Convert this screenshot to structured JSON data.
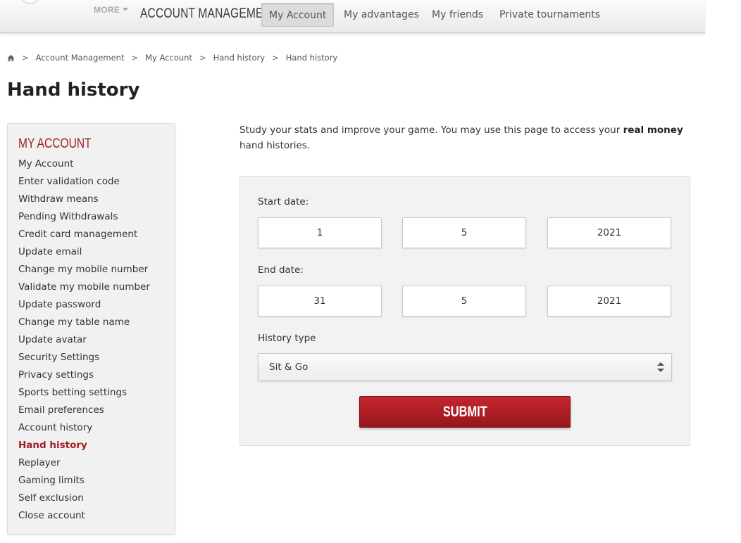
{
  "nav": {
    "more_label": "MORE",
    "title": "ACCOUNT MANAGEMENT",
    "tabs": [
      {
        "label": "My Account",
        "active": true
      },
      {
        "label": "My advantages"
      },
      {
        "label": "My friends"
      },
      {
        "label": "Private tournaments"
      }
    ]
  },
  "breadcrumb": [
    "Account Management",
    "My Account",
    "Hand history",
    "Hand history"
  ],
  "page_title": "Hand history",
  "sidebar": {
    "title": "MY ACCOUNT",
    "items": [
      "My Account",
      "Enter validation code",
      "Withdraw means",
      "Pending Withdrawals",
      "Credit card management",
      "Update email",
      "Change my mobile number",
      "Validate my mobile number",
      "Update password",
      "Change my table name",
      "Update avatar",
      "Security Settings",
      "Privacy settings",
      "Sports betting settings",
      "Email preferences",
      "Account history",
      "Hand history",
      "Replayer",
      "Gaming limits",
      "Self exclusion",
      "Close account"
    ],
    "active_item": "Hand history"
  },
  "intro": {
    "before": "Study your stats and improve your game. You may use this page to access your ",
    "bold": "real money",
    "after": " hand histories."
  },
  "form": {
    "start_label": "Start date:",
    "start": {
      "day": "1",
      "month": "5",
      "year": "2021"
    },
    "end_label": "End date:",
    "end": {
      "day": "31",
      "month": "5",
      "year": "2021"
    },
    "history_type_label": "History type",
    "history_type_value": "Sit & Go",
    "submit_label": "SUBMIT"
  },
  "colors": {
    "accent": "#a31d24",
    "button": "#b21f26"
  }
}
